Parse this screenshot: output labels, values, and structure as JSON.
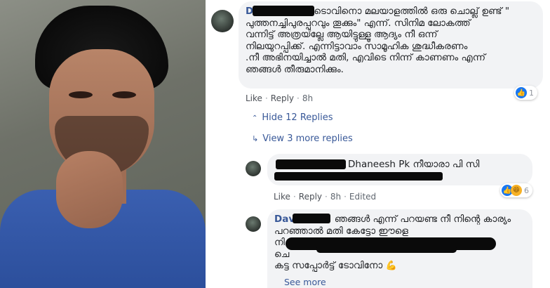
{
  "comment1": {
    "author": "D",
    "text_lines": [
      "ടൊവിനൊ മലയാളത്തിൽ ഒരു ചൊല്ല് ഉണ്ട് \"",
      "പുത്തനച്ചിപുരപ്പുറവും തൂക്കും\" എന്ന്. സിനിമ ലോകത്ത്",
      "വന്നിട്ട് അത്രയല്ലേ ആയിട്ടുള്ളൂ ആദ്യം നീ ഒന്ന്",
      "നിലയുറപ്പിക്ക്. എന്നിട്ടാവാം സാമൂഹിക ശുദ്ധീകരണം",
      ".നീ അഭിനയിച്ചാൽ മതി, എവിടെ നിന്ന് കാണണം എന്ന്",
      "ഞങ്ങൾ തീരുമാനിക്കും."
    ],
    "actions": {
      "like": "Like",
      "reply": "Reply",
      "time": "8h"
    },
    "reaction_count": "1"
  },
  "replies_toggle": {
    "hide": "Hide 12 Replies",
    "view_more": "View 3 more replies"
  },
  "reply1": {
    "text": "Dhaneesh Pk നീയാരാ പി സി",
    "actions": {
      "like": "Like",
      "reply": "Reply",
      "time": "8h",
      "edited": "Edited"
    },
    "reaction_count": "6"
  },
  "reply2": {
    "author": "Davi",
    "text_lines": [
      "ഞങ്ങൾ എന്ന് പറയണ്ട നീ നിന്റെ കാര്യം",
      "പറഞ്ഞാൽ മതി കേട്ടോ ഈളെ",
      "നി",
      "ചെ",
      "കട്ട സപ്പോർട്ട് ടോവിനോ"
    ],
    "see_more": "See more"
  },
  "colors": {
    "link": "#385898",
    "bubble": "#f2f3f5",
    "like_blue": "#1877f2"
  }
}
